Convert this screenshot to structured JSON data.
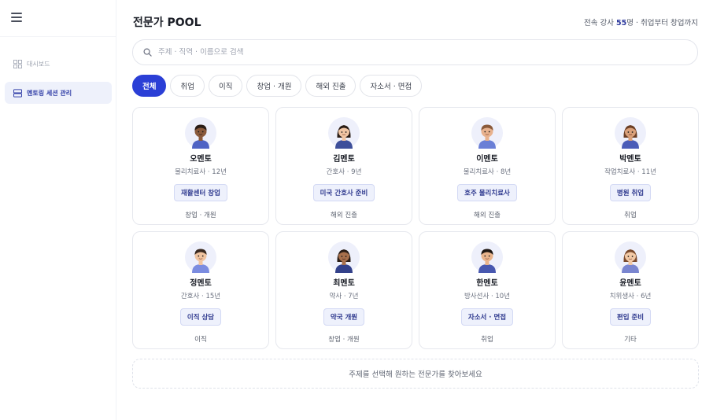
{
  "sidebar": {
    "items": [
      {
        "label": "대시보드",
        "icon": "grid-icon"
      },
      {
        "label": "멘토링 세션 관리",
        "icon": "layers-icon"
      }
    ]
  },
  "header": {
    "title": "전문가 POOL",
    "subtitle_prefix": "전속 강사 ",
    "subtitle_count": "55",
    "subtitle_suffix": "명 · 취업부터 창업까지"
  },
  "search": {
    "placeholder": "주제 · 직역 · 이름으로 검색",
    "value": ""
  },
  "tabs": [
    {
      "label": "전체"
    },
    {
      "label": "취업"
    },
    {
      "label": "이직"
    },
    {
      "label": "창업 · 개원"
    },
    {
      "label": "해외 진출"
    },
    {
      "label": "자소서 · 면접"
    }
  ],
  "mentors": [
    {
      "name": "오멘토",
      "role": "물리치료사 · 12년",
      "topic": "재활센터 창업",
      "category": "창업 · 개원"
    },
    {
      "name": "김멘토",
      "role": "간호사 · 9년",
      "topic": "미국 간호사 준비",
      "category": "해외 진출"
    },
    {
      "name": "이멘토",
      "role": "물리치료사 · 8년",
      "topic": "호주 물리치료사",
      "category": "해외 진출"
    },
    {
      "name": "박멘토",
      "role": "작업치료사 · 11년",
      "topic": "병원 취업",
      "category": "취업"
    },
    {
      "name": "정멘토",
      "role": "간호사 · 15년",
      "topic": "이직 상담",
      "category": "이직"
    },
    {
      "name": "최멘토",
      "role": "약사 · 7년",
      "topic": "약국 개원",
      "category": "창업 · 개원"
    },
    {
      "name": "한멘토",
      "role": "방사선사 · 10년",
      "topic": "자소서 · 면접",
      "category": "취업"
    },
    {
      "name": "윤멘토",
      "role": "치위생사 · 6년",
      "topic": "편입 준비",
      "category": "기타"
    }
  ],
  "hint": "주제를 선택해 원하는 전문가를 찾아보세요",
  "colors": {
    "accent": "#2b3fd6",
    "topic_bg": "#eef1fc",
    "topic_text": "#2f3a8f",
    "sidebar_active_bg": "#eef1fb"
  }
}
